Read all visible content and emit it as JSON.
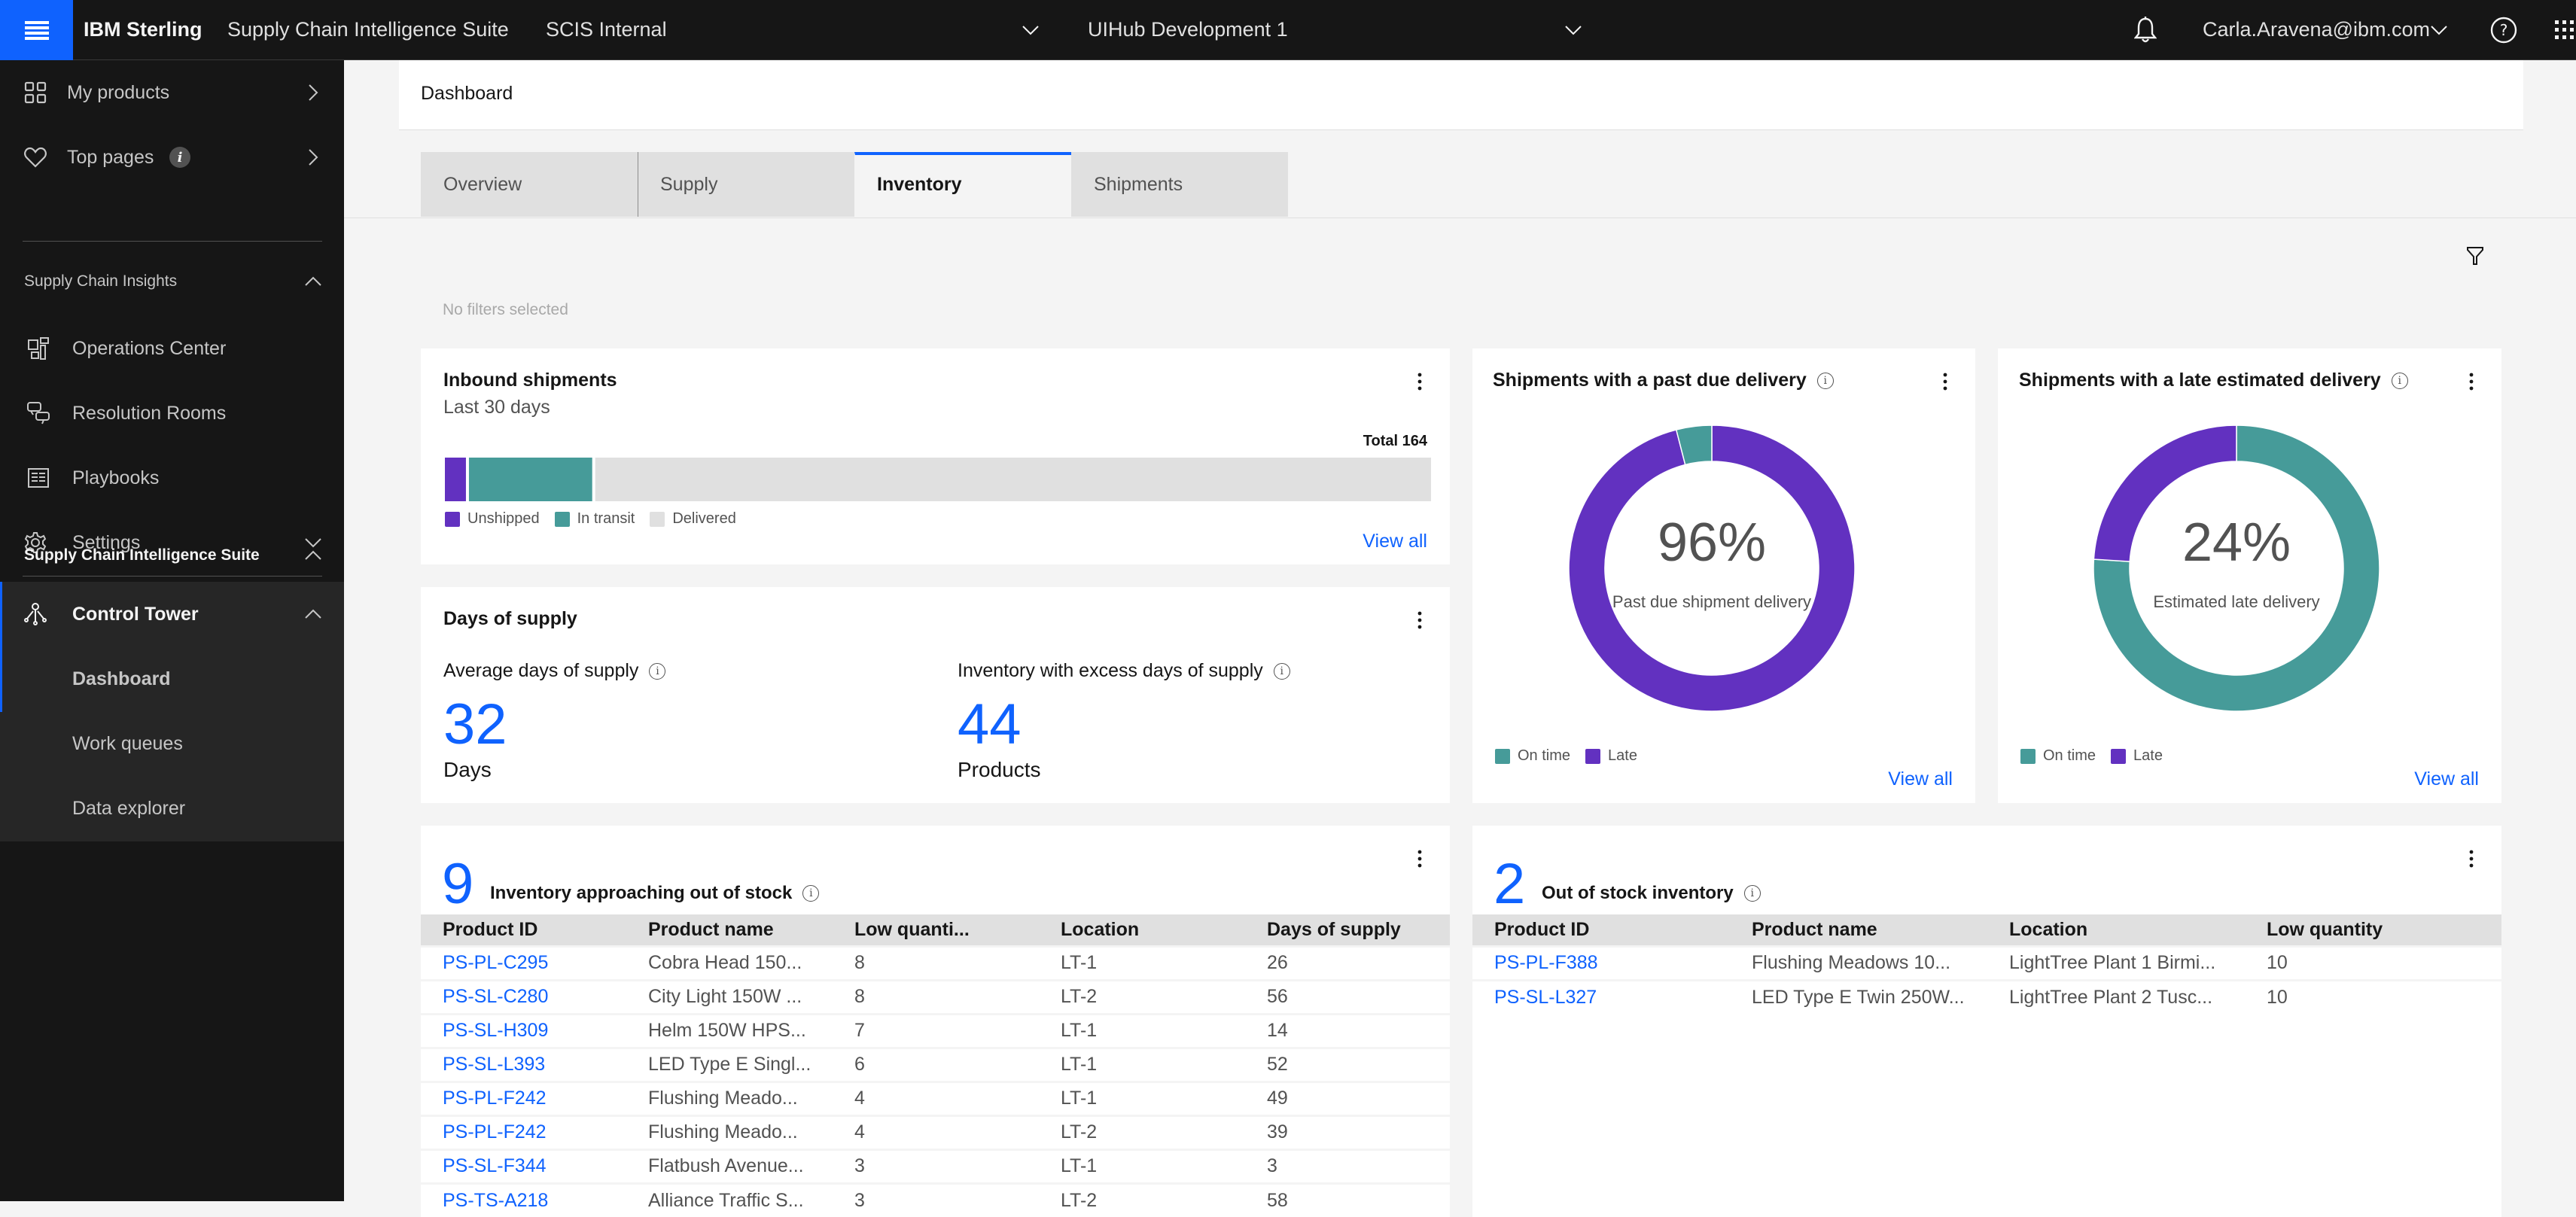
{
  "header": {
    "brand": "IBM Sterling",
    "suite": "Supply Chain Intelligence Suite",
    "org_selector": "SCIS Internal",
    "env_selector": "UIHub Development 1",
    "user": "Carla.Aravena@ibm.com",
    "icons": [
      "menu-icon",
      "chevron-down-icon",
      "notification-bell-icon",
      "help-icon",
      "app-switcher-icon"
    ]
  },
  "sidebar": {
    "top_items": [
      {
        "label": "My products",
        "icon": "grid-icon"
      },
      {
        "label": "Top pages",
        "icon": "heart-icon",
        "badge": "i"
      }
    ],
    "section1": {
      "label": "Supply Chain Insights",
      "items": [
        {
          "label": "Operations Center",
          "icon": "dashboard-icon"
        },
        {
          "label": "Resolution Rooms",
          "icon": "chat-icon"
        },
        {
          "label": "Playbooks",
          "icon": "book-icon"
        },
        {
          "label": "Settings",
          "icon": "gear-icon"
        }
      ]
    },
    "section2": {
      "label": "Supply Chain Intelligence Suite",
      "group": {
        "label": "Control Tower",
        "icon": "network-icon"
      },
      "children": [
        {
          "label": "Dashboard",
          "active": true
        },
        {
          "label": "Work queues"
        },
        {
          "label": "Data explorer"
        }
      ]
    }
  },
  "breadcrumb": "Dashboard",
  "tabs": [
    {
      "label": "Overview"
    },
    {
      "label": "Supply"
    },
    {
      "label": "Inventory",
      "active": true
    },
    {
      "label": "Shipments"
    }
  ],
  "filters": {
    "status": "No filters selected"
  },
  "colors": {
    "accent": "#0f62fe",
    "purple": "#6231c0",
    "teal": "#469b99",
    "neutral": "#e0e0e0"
  },
  "inbound": {
    "title": "Inbound shipments",
    "subtitle": "Last 30 days",
    "total_label": "Total 164",
    "view_all": "View all"
  },
  "days_of_supply": {
    "title": "Days of supply",
    "kpis": [
      {
        "label": "Average days of supply",
        "value": "32",
        "unit": "Days"
      },
      {
        "label": "Inventory with excess days of supply",
        "value": "44",
        "unit": "Products"
      }
    ]
  },
  "past_due": {
    "title": "Shipments with a past due delivery",
    "center_value": "96%",
    "center_label": "Past due shipment delivery",
    "legend": [
      "On time",
      "Late"
    ],
    "view_all": "View all"
  },
  "late_estimated": {
    "title": "Shipments with a late estimated delivery",
    "center_value": "24%",
    "center_label": "Estimated late delivery",
    "legend": [
      "On time",
      "Late"
    ],
    "view_all": "View all"
  },
  "approaching": {
    "count": "9",
    "title": "Inventory approaching out of stock",
    "columns": [
      "Product ID",
      "Product name",
      "Low quanti...",
      "Location",
      "Days of supply"
    ],
    "rows": [
      [
        "PS-PL-C295",
        "Cobra Head 150...",
        "8",
        "LT-1",
        "26"
      ],
      [
        "PS-SL-C280",
        "City Light 150W ...",
        "8",
        "LT-2",
        "56"
      ],
      [
        "PS-SL-H309",
        "Helm 150W HPS...",
        "7",
        "LT-1",
        "14"
      ],
      [
        "PS-SL-L393",
        "LED Type E Singl...",
        "6",
        "LT-1",
        "52"
      ],
      [
        "PS-PL-F242",
        "Flushing Meado...",
        "4",
        "LT-1",
        "49"
      ],
      [
        "PS-PL-F242",
        "Flushing Meado...",
        "4",
        "LT-2",
        "39"
      ],
      [
        "PS-SL-F344",
        "Flatbush Avenue...",
        "3",
        "LT-1",
        "3"
      ],
      [
        "PS-TS-A218",
        "Alliance Traffic S...",
        "3",
        "LT-2",
        "58"
      ]
    ]
  },
  "out_of_stock": {
    "count": "2",
    "title": "Out of stock inventory",
    "columns": [
      "Product ID",
      "Product name",
      "Location",
      "Low quantity"
    ],
    "rows": [
      [
        "PS-PL-F388",
        "Flushing Meadows 10...",
        "LightTree Plant 1 Birmi...",
        "10"
      ],
      [
        "PS-SL-L327",
        "LED Type E Twin 250W...",
        "LightTree Plant 2 Tusc...",
        "10"
      ]
    ]
  },
  "chart_data": [
    {
      "type": "bar",
      "title": "Inbound shipments",
      "subtitle": "Last 30 days",
      "orientation": "horizontal-stacked",
      "categories": [
        "Inbound"
      ],
      "series": [
        {
          "name": "Unshipped",
          "values": [
            4
          ],
          "color": "#6231c0"
        },
        {
          "name": "In transit",
          "values": [
            21
          ],
          "color": "#469b99"
        },
        {
          "name": "Delivered",
          "values": [
            139
          ],
          "color": "#e0e0e0"
        }
      ],
      "total": 164,
      "legend": "bottom-left"
    },
    {
      "type": "pie",
      "title": "Shipments with a past due delivery",
      "donut": true,
      "labels": [
        "On time",
        "Late"
      ],
      "values": [
        4,
        96
      ],
      "colors": [
        "#469b99",
        "#6231c0"
      ],
      "center": "96%",
      "legend": "bottom-left"
    },
    {
      "type": "pie",
      "title": "Shipments with a late estimated delivery",
      "donut": true,
      "labels": [
        "On time",
        "Late"
      ],
      "values": [
        76,
        24
      ],
      "colors": [
        "#469b99",
        "#6231c0"
      ],
      "center": "24%",
      "legend": "bottom-left"
    }
  ]
}
